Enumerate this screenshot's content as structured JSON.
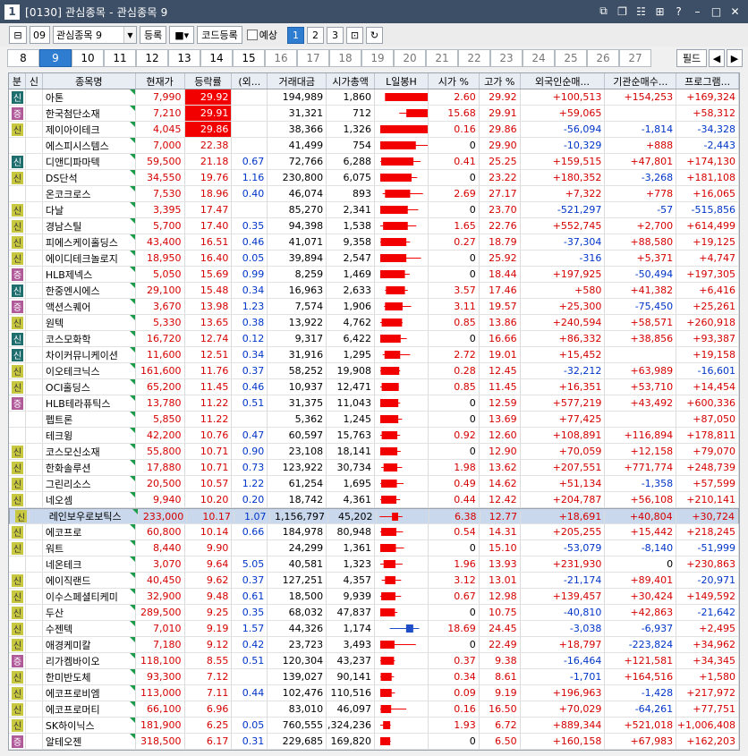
{
  "window": {
    "number": "1",
    "title": "[0130] 관심종목 - 관심종목 9"
  },
  "toolbar": {
    "group_no": "09",
    "group_name": "관심종목 9",
    "register": "등록",
    "code_register": "코드등록",
    "forecast": "예상",
    "views": [
      "1",
      "2",
      "3"
    ],
    "active_view": "1"
  },
  "pages": {
    "tabs": [
      "8",
      "9",
      "10",
      "11",
      "12",
      "13",
      "14",
      "15",
      "16",
      "17",
      "18",
      "19",
      "20",
      "21",
      "22",
      "23",
      "24",
      "25",
      "26",
      "27"
    ],
    "active": "9",
    "filter": "필드"
  },
  "columns": [
    "분",
    "신",
    "종목명",
    "현재가",
    "등락률",
    "(외...",
    "거래대금",
    "시가총액",
    "L일봉H",
    "시가 %",
    "고가 %",
    "외국인순매...",
    "기관순매수...",
    "프로그램..."
  ],
  "colors": {
    "up": "#d60000",
    "down": "#0035c8",
    "selected_row": "#c9d8ec",
    "limit_up": "#f20000"
  },
  "rows": [
    {
      "b": "신",
      "bc": "sin",
      "name": "아톤",
      "price": "7,990",
      "chg": "29.92",
      "hl": true,
      "ex": "",
      "vol": "194,989",
      "cap": "1,860",
      "open": "2.60",
      "high": "29.92",
      "frn": "+100,513",
      "inst": "+154,253",
      "prog": "+169,324",
      "k": [
        0.1,
        1,
        0.6,
        1
      ]
    },
    {
      "b": "증",
      "bc": "jeung",
      "name": "한국첨단소재",
      "price": "7,210",
      "chg": "29.91",
      "hl": true,
      "ex": "",
      "vol": "31,321",
      "cap": "712",
      "open": "15.68",
      "high": "29.91",
      "frn": "+59,065",
      "inst": "",
      "prog": "+58,312",
      "k": [
        0.55,
        1,
        0.4,
        1
      ]
    },
    {
      "b": "신",
      "bc": "yellow",
      "name": "제이아이테크",
      "price": "4,045",
      "chg": "29.86",
      "hl": true,
      "ex": "",
      "vol": "38,366",
      "cap": "1,326",
      "open": "0.16",
      "high": "29.86",
      "frn": "-56,094",
      "inst": "-1,814",
      "prog": "-34,328",
      "k": [
        0,
        1,
        0,
        1
      ]
    },
    {
      "b": "",
      "bc": "",
      "name": "에스피시스템스",
      "price": "7,000",
      "chg": "22.38",
      "hl": false,
      "ex": "",
      "vol": "41,499",
      "cap": "754",
      "open": "0",
      "high": "29.90",
      "frn": "-10,329",
      "inst": "+888",
      "prog": "-2,443",
      "k": [
        0,
        0.75,
        0,
        1
      ]
    },
    {
      "b": "신",
      "bc": "sin",
      "name": "디앤디파마텍",
      "price": "59,500",
      "chg": "21.18",
      "hl": false,
      "ex": "0.67",
      "vol": "72,766",
      "cap": "6,288",
      "open": "0.41",
      "high": "25.25",
      "frn": "+159,515",
      "inst": "+47,801",
      "prog": "+174,130",
      "k": [
        0.02,
        0.7,
        0,
        0.85
      ]
    },
    {
      "b": "신",
      "bc": "yellow",
      "name": "DS단석",
      "price": "34,550",
      "chg": "19.76",
      "hl": false,
      "ex": "1.16",
      "vol": "230,800",
      "cap": "6,075",
      "open": "0",
      "high": "23.22",
      "frn": "+180,352",
      "inst": "-3,268",
      "prog": "+181,108",
      "k": [
        0,
        0.66,
        0,
        0.78
      ]
    },
    {
      "b": "",
      "bc": "",
      "name": "온코크로스",
      "price": "7,530",
      "chg": "18.96",
      "hl": false,
      "ex": "0.40",
      "vol": "46,074",
      "cap": "893",
      "open": "2.69",
      "high": "27.17",
      "frn": "+7,322",
      "inst": "+778",
      "prog": "+16,065",
      "k": [
        0.1,
        0.63,
        0.05,
        0.9
      ]
    },
    {
      "b": "신",
      "bc": "yellow",
      "name": "다날",
      "price": "3,395",
      "chg": "17.47",
      "hl": false,
      "ex": "",
      "vol": "85,270",
      "cap": "2,341",
      "open": "0",
      "high": "23.70",
      "frn": "-521,297",
      "inst": "-57",
      "prog": "-515,856",
      "k": [
        0,
        0.58,
        0,
        0.8
      ]
    },
    {
      "b": "신",
      "bc": "yellow",
      "name": "경남스틸",
      "price": "5,700",
      "chg": "17.40",
      "hl": false,
      "ex": "0.35",
      "vol": "94,398",
      "cap": "1,538",
      "open": "1.65",
      "high": "22.76",
      "frn": "+552,745",
      "inst": "+2,700",
      "prog": "+614,499",
      "k": [
        0.06,
        0.58,
        0,
        0.76
      ]
    },
    {
      "b": "신",
      "bc": "yellow",
      "name": "피에스케이홀딩스",
      "price": "43,400",
      "chg": "16.51",
      "hl": false,
      "ex": "0.46",
      "vol": "41,071",
      "cap": "9,358",
      "open": "0.27",
      "high": "18.79",
      "frn": "-37,304",
      "inst": "+88,580",
      "prog": "+19,125",
      "k": [
        0.01,
        0.55,
        0,
        0.63
      ]
    },
    {
      "b": "신",
      "bc": "yellow",
      "name": "에이디테크놀로지",
      "price": "18,950",
      "chg": "16.40",
      "hl": false,
      "ex": "0.05",
      "vol": "39,894",
      "cap": "2,547",
      "open": "0",
      "high": "25.92",
      "frn": "-316",
      "inst": "+5,371",
      "prog": "+4,747",
      "k": [
        0,
        0.55,
        0,
        0.86
      ]
    },
    {
      "b": "증",
      "bc": "jeung",
      "name": "HLB제넥스",
      "price": "5,050",
      "chg": "15.69",
      "hl": false,
      "ex": "0.99",
      "vol": "8,259",
      "cap": "1,469",
      "open": "0",
      "high": "18.44",
      "frn": "+197,925",
      "inst": "-50,494",
      "prog": "+197,305",
      "k": [
        0,
        0.52,
        0,
        0.62
      ]
    },
    {
      "b": "신",
      "bc": "sin",
      "name": "한중엔시에스",
      "price": "29,100",
      "chg": "15.48",
      "hl": false,
      "ex": "0.34",
      "vol": "16,963",
      "cap": "2,633",
      "open": "3.57",
      "high": "17.46",
      "frn": "+580",
      "inst": "+41,382",
      "prog": "+6,416",
      "k": [
        0.12,
        0.52,
        0.1,
        0.58
      ]
    },
    {
      "b": "증",
      "bc": "jeung",
      "name": "액션스퀘어",
      "price": "3,670",
      "chg": "13.98",
      "hl": false,
      "ex": "1.23",
      "vol": "7,574",
      "cap": "1,906",
      "open": "3.11",
      "high": "19.57",
      "frn": "+25,300",
      "inst": "-75,450",
      "prog": "+25,261",
      "k": [
        0.1,
        0.47,
        0.08,
        0.65
      ]
    },
    {
      "b": "신",
      "bc": "yellow",
      "name": "원텍",
      "price": "5,330",
      "chg": "13.65",
      "hl": false,
      "ex": "0.38",
      "vol": "13,922",
      "cap": "4,762",
      "open": "0.85",
      "high": "13.86",
      "frn": "+240,594",
      "inst": "+58,571",
      "prog": "+260,918",
      "k": [
        0.03,
        0.46,
        0,
        0.47
      ]
    },
    {
      "b": "신",
      "bc": "sin",
      "name": "코스모화학",
      "price": "16,720",
      "chg": "12.74",
      "hl": false,
      "ex": "0.12",
      "vol": "9,317",
      "cap": "6,422",
      "open": "0",
      "high": "16.66",
      "frn": "+86,332",
      "inst": "+38,856",
      "prog": "+93,387",
      "k": [
        0,
        0.43,
        0,
        0.56
      ]
    },
    {
      "b": "신",
      "bc": "sin",
      "name": "차이커뮤니케이션",
      "price": "11,600",
      "chg": "12.51",
      "hl": false,
      "ex": "0.34",
      "vol": "31,916",
      "cap": "1,295",
      "open": "2.72",
      "high": "19.01",
      "frn": "+15,452",
      "inst": "",
      "prog": "+19,158",
      "k": [
        0.09,
        0.42,
        0.05,
        0.63
      ]
    },
    {
      "b": "신",
      "bc": "yellow",
      "name": "이오테크닉스",
      "price": "161,600",
      "chg": "11.76",
      "hl": false,
      "ex": "0.37",
      "vol": "58,252",
      "cap": "19,908",
      "open": "0.28",
      "high": "12.45",
      "frn": "-32,212",
      "inst": "+63,989",
      "prog": "-16,601",
      "k": [
        0.01,
        0.4,
        0,
        0.42
      ]
    },
    {
      "b": "신",
      "bc": "yellow",
      "name": "OCI홀딩스",
      "price": "65,200",
      "chg": "11.45",
      "hl": false,
      "ex": "0.46",
      "vol": "10,937",
      "cap": "12,471",
      "open": "0.85",
      "high": "11.45",
      "frn": "+16,351",
      "inst": "+53,710",
      "prog": "+14,454",
      "k": [
        0.03,
        0.39,
        0,
        0.39
      ]
    },
    {
      "b": "증",
      "bc": "jeung",
      "name": "HLB테라퓨틱스",
      "price": "13,780",
      "chg": "11.22",
      "hl": false,
      "ex": "0.51",
      "vol": "31,375",
      "cap": "11,043",
      "open": "0",
      "high": "12.59",
      "frn": "+577,219",
      "inst": "+43,492",
      "prog": "+600,336",
      "k": [
        0,
        0.38,
        0,
        0.42
      ]
    },
    {
      "b": "",
      "bc": "",
      "name": "펩트론",
      "price": "5,850",
      "chg": "11.22",
      "hl": false,
      "ex": "",
      "vol": "5,362",
      "cap": "1,245",
      "open": "0",
      "high": "13.69",
      "frn": "+77,425",
      "inst": "",
      "prog": "+87,050",
      "k": [
        0,
        0.38,
        0,
        0.46
      ]
    },
    {
      "b": "",
      "bc": "",
      "name": "테크윙",
      "price": "42,200",
      "chg": "10.76",
      "hl": false,
      "ex": "0.47",
      "vol": "60,597",
      "cap": "15,763",
      "open": "0.92",
      "high": "12.60",
      "frn": "+108,891",
      "inst": "+116,894",
      "prog": "+178,811",
      "k": [
        0.03,
        0.36,
        0,
        0.42
      ]
    },
    {
      "b": "신",
      "bc": "yellow",
      "name": "코스모신소재",
      "price": "55,800",
      "chg": "10.71",
      "hl": false,
      "ex": "0.90",
      "vol": "23,108",
      "cap": "18,141",
      "open": "0",
      "high": "12.90",
      "frn": "+70,059",
      "inst": "+12,158",
      "prog": "+79,070",
      "k": [
        0,
        0.36,
        0,
        0.43
      ]
    },
    {
      "b": "신",
      "bc": "yellow",
      "name": "한화솔루션",
      "price": "17,880",
      "chg": "10.71",
      "hl": false,
      "ex": "0.73",
      "vol": "123,922",
      "cap": "30,734",
      "open": "1.98",
      "high": "13.62",
      "frn": "+207,551",
      "inst": "+771,774",
      "prog": "+248,739",
      "k": [
        0.07,
        0.36,
        0.02,
        0.46
      ]
    },
    {
      "b": "신",
      "bc": "yellow",
      "name": "그린리소스",
      "price": "20,500",
      "chg": "10.57",
      "hl": false,
      "ex": "1.22",
      "vol": "61,254",
      "cap": "1,695",
      "open": "0.49",
      "high": "14.62",
      "frn": "+51,134",
      "inst": "-1,358",
      "prog": "+57,599",
      "k": [
        0.02,
        0.35,
        0,
        0.49
      ]
    },
    {
      "b": "신",
      "bc": "yellow",
      "name": "네오셈",
      "price": "9,940",
      "chg": "10.20",
      "hl": false,
      "ex": "0.20",
      "vol": "18,742",
      "cap": "4,361",
      "open": "0.44",
      "high": "12.42",
      "frn": "+204,787",
      "inst": "+56,108",
      "prog": "+210,141",
      "k": [
        0.02,
        0.34,
        0,
        0.42
      ]
    },
    {
      "b": "신",
      "bc": "yellow",
      "name": "레인보우로보틱스",
      "price": "233,000",
      "chg": "10.17",
      "hl": false,
      "ex": "1.07",
      "vol": "1,156,797",
      "cap": "45,202",
      "open": "6.38",
      "high": "12.77",
      "frn": "+18,691",
      "inst": "+40,804",
      "prog": "+30,724",
      "k": [
        0.21,
        0.34,
        -0.05,
        0.43
      ],
      "sel": true
    },
    {
      "b": "신",
      "bc": "yellow",
      "name": "에코프로",
      "price": "60,800",
      "chg": "10.14",
      "hl": false,
      "ex": "0.66",
      "vol": "184,978",
      "cap": "80,948",
      "open": "0.54",
      "high": "14.31",
      "frn": "+205,255",
      "inst": "+15,442",
      "prog": "+218,245",
      "k": [
        0.02,
        0.34,
        0,
        0.48
      ]
    },
    {
      "b": "신",
      "bc": "yellow",
      "name": "워트",
      "price": "8,440",
      "chg": "9.90",
      "hl": false,
      "ex": "",
      "vol": "24,299",
      "cap": "1,361",
      "open": "0",
      "high": "15.10",
      "frn": "-53,079",
      "inst": "-8,140",
      "prog": "-51,999",
      "k": [
        0,
        0.33,
        0,
        0.5
      ]
    },
    {
      "b": "",
      "bc": "",
      "name": "네온테크",
      "price": "3,070",
      "chg": "9.64",
      "hl": false,
      "ex": "5.05",
      "vol": "40,581",
      "cap": "1,323",
      "open": "1.96",
      "high": "13.93",
      "frn": "+231,930",
      "inst": "0",
      "prog": "+230,863",
      "k": [
        0.07,
        0.32,
        0,
        0.47
      ]
    },
    {
      "b": "신",
      "bc": "yellow",
      "name": "에이직랜드",
      "price": "40,450",
      "chg": "9.62",
      "hl": false,
      "ex": "0.37",
      "vol": "127,251",
      "cap": "4,357",
      "open": "3.12",
      "high": "13.01",
      "frn": "-21,174",
      "inst": "+89,401",
      "prog": "-20,971",
      "k": [
        0.1,
        0.32,
        0.03,
        0.44
      ]
    },
    {
      "b": "신",
      "bc": "yellow",
      "name": "이수스페셜티케미",
      "price": "32,900",
      "chg": "9.48",
      "hl": false,
      "ex": "0.61",
      "vol": "18,500",
      "cap": "9,939",
      "open": "0.67",
      "high": "12.98",
      "frn": "+139,457",
      "inst": "+30,424",
      "prog": "+149,592",
      "k": [
        0.02,
        0.32,
        0,
        0.44
      ]
    },
    {
      "b": "신",
      "bc": "yellow",
      "name": "두산",
      "price": "289,500",
      "chg": "9.25",
      "hl": false,
      "ex": "0.35",
      "vol": "68,032",
      "cap": "47,837",
      "open": "0",
      "high": "10.75",
      "frn": "-40,810",
      "inst": "+42,863",
      "prog": "-21,642",
      "k": [
        0,
        0.31,
        0,
        0.36
      ]
    },
    {
      "b": "신",
      "bc": "yellow",
      "name": "수젠텍",
      "price": "7,010",
      "chg": "9.19",
      "hl": false,
      "ex": "1.57",
      "vol": "44,326",
      "cap": "1,174",
      "open": "18.69",
      "high": "24.45",
      "frn": "-3,038",
      "inst": "-6,937",
      "prog": "+2,495",
      "k": [
        0.62,
        0.31,
        0.2,
        0.82
      ],
      "down": true
    },
    {
      "b": "신",
      "bc": "yellow",
      "name": "애경케미칼",
      "price": "7,180",
      "chg": "9.12",
      "hl": false,
      "ex": "0.42",
      "vol": "23,723",
      "cap": "3,493",
      "open": "0",
      "high": "22.49",
      "frn": "+18,797",
      "inst": "-223,824",
      "prog": "+34,962",
      "k": [
        0,
        0.3,
        0,
        0.75
      ]
    },
    {
      "b": "증",
      "bc": "jeung",
      "name": "리가켐바이오",
      "price": "118,100",
      "chg": "8.55",
      "hl": false,
      "ex": "0.51",
      "vol": "120,304",
      "cap": "43,237",
      "open": "0.37",
      "high": "9.38",
      "frn": "-16,464",
      "inst": "+121,581",
      "prog": "+34,345",
      "k": [
        0.01,
        0.29,
        0,
        0.31
      ]
    },
    {
      "b": "신",
      "bc": "yellow",
      "name": "한미반도체",
      "price": "93,300",
      "chg": "7.12",
      "hl": false,
      "ex": "",
      "vol": "139,027",
      "cap": "90,141",
      "open": "0.34",
      "high": "8.61",
      "frn": "-1,701",
      "inst": "+164,516",
      "prog": "+1,580",
      "k": [
        0.01,
        0.24,
        0,
        0.29
      ]
    },
    {
      "b": "신",
      "bc": "yellow",
      "name": "에코프로비엠",
      "price": "113,000",
      "chg": "7.11",
      "hl": false,
      "ex": "0.44",
      "vol": "102,476",
      "cap": "110,516",
      "open": "0.09",
      "high": "9.19",
      "frn": "+196,963",
      "inst": "-1,428",
      "prog": "+217,972",
      "k": [
        0,
        0.24,
        0,
        0.31
      ]
    },
    {
      "b": "신",
      "bc": "yellow",
      "name": "에코프로머티",
      "price": "66,100",
      "chg": "6.96",
      "hl": false,
      "ex": "",
      "vol": "83,010",
      "cap": "46,097",
      "open": "0.16",
      "high": "16.50",
      "frn": "+70,029",
      "inst": "-64,261",
      "prog": "+77,751",
      "k": [
        0.01,
        0.23,
        0,
        0.55
      ]
    },
    {
      "b": "신",
      "bc": "yellow",
      "name": "SK하이닉스",
      "price": "181,900",
      "chg": "6.25",
      "hl": false,
      "ex": "0.05",
      "vol": "760,555",
      "cap": ",324,236",
      "open": "1.93",
      "high": "6.72",
      "frn": "+889,344",
      "inst": "+521,018",
      "prog": "+1,006,408",
      "k": [
        0.06,
        0.21,
        0,
        0.22
      ]
    },
    {
      "b": "증",
      "bc": "jeung",
      "name": "알테오젠",
      "price": "318,500",
      "chg": "6.17",
      "hl": false,
      "ex": "0.31",
      "vol": "229,685",
      "cap": "169,820",
      "open": "0",
      "high": "6.50",
      "frn": "+160,158",
      "inst": "+67,983",
      "prog": "+162,203",
      "k": [
        0,
        0.21,
        0,
        0.22
      ]
    }
  ]
}
